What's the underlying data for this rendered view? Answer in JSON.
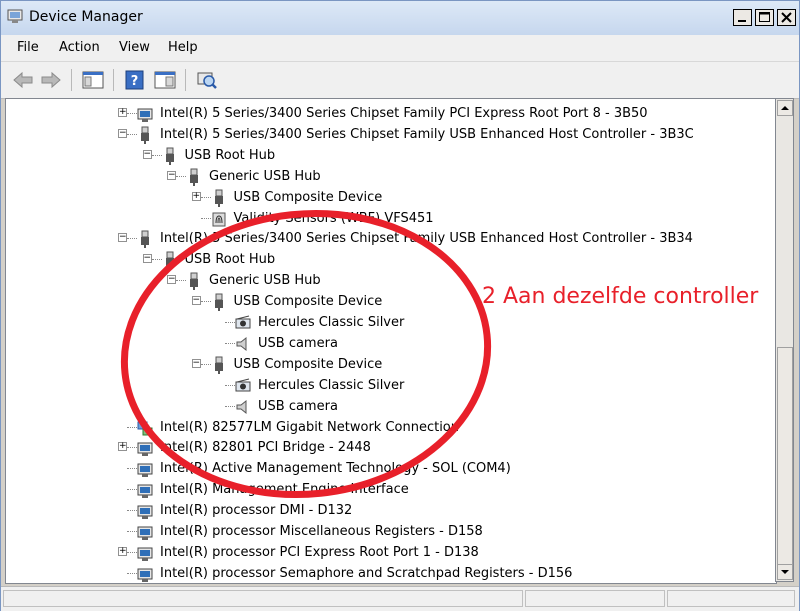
{
  "window": {
    "title": "Device Manager"
  },
  "menu": {
    "items": [
      "File",
      "Action",
      "View",
      "Help"
    ]
  },
  "colors": {
    "annotation": "#e8202a",
    "titlebar": "#dde9f7",
    "selection_line": "#000"
  },
  "tree": {
    "rows": [
      {
        "text": "Intel(R) 5 Series/3400 Series Chipset Family PCI Express Root Port 8 - 3B50",
        "level": 0,
        "expander": "+",
        "icon": "pci-device-icon"
      },
      {
        "text": "Intel(R) 5 Series/3400 Series Chipset Family USB Enhanced Host Controller - 3B3C",
        "level": 0,
        "expander": "-",
        "icon": "usb-plug-icon"
      },
      {
        "text": "USB Root Hub",
        "level": 1,
        "expander": "-",
        "icon": "usb-plug-icon"
      },
      {
        "text": "Generic USB Hub",
        "level": 2,
        "expander": "-",
        "icon": "usb-plug-icon"
      },
      {
        "text": "USB Composite Device",
        "level": 3,
        "expander": "+",
        "icon": "usb-plug-icon"
      },
      {
        "text": "Validity Sensors (WBF) VFS451",
        "level": 3,
        "expander": "",
        "icon": "fingerprint-sensor-icon"
      },
      {
        "text": "Intel(R) 5 Series/3400 Series Chipset Family USB Enhanced Host Controller - 3B34",
        "level": 0,
        "expander": "-",
        "icon": "usb-plug-icon"
      },
      {
        "text": "USB Root Hub",
        "level": 1,
        "expander": "-",
        "icon": "usb-plug-icon"
      },
      {
        "text": "Generic USB Hub",
        "level": 2,
        "expander": "-",
        "icon": "usb-plug-icon"
      },
      {
        "text": "USB Composite Device",
        "level": 3,
        "expander": "-",
        "icon": "usb-plug-icon"
      },
      {
        "text": "Hercules Classic Silver",
        "level": 4,
        "expander": "",
        "icon": "webcam-icon"
      },
      {
        "text": "USB camera",
        "level": 4,
        "expander": "",
        "icon": "speaker-icon"
      },
      {
        "text": "USB Composite Device",
        "level": 3,
        "expander": "-",
        "icon": "usb-plug-icon"
      },
      {
        "text": "Hercules Classic Silver",
        "level": 4,
        "expander": "",
        "icon": "webcam-icon"
      },
      {
        "text": "USB camera",
        "level": 4,
        "expander": "",
        "icon": "speaker-icon"
      },
      {
        "text": "Intel(R) 82577LM Gigabit Network Connection",
        "level": 0,
        "expander": "",
        "icon": "network-adapter-icon"
      },
      {
        "text": "Intel(R) 82801 PCI Bridge - 2448",
        "level": 0,
        "expander": "+",
        "icon": "pci-device-icon"
      },
      {
        "text": "Intel(R) Active Management Technology - SOL (COM4)",
        "level": 0,
        "expander": "",
        "icon": "pci-device-icon"
      },
      {
        "text": "Intel(R) Management Engine Interface",
        "level": 0,
        "expander": "",
        "icon": "pci-device-icon"
      },
      {
        "text": "Intel(R) processor DMI - D132",
        "level": 0,
        "expander": "",
        "icon": "pci-device-icon"
      },
      {
        "text": "Intel(R) processor Miscellaneous Registers - D158",
        "level": 0,
        "expander": "",
        "icon": "pci-device-icon"
      },
      {
        "text": "Intel(R) processor PCI Express Root Port 1 - D138",
        "level": 0,
        "expander": "+",
        "icon": "pci-device-icon"
      },
      {
        "text": "Intel(R) processor Semaphore and Scratchpad Registers - D156",
        "level": 0,
        "expander": "",
        "icon": "pci-device-icon"
      }
    ]
  },
  "annotation": {
    "text": "2 Aan dezelfde controller"
  }
}
